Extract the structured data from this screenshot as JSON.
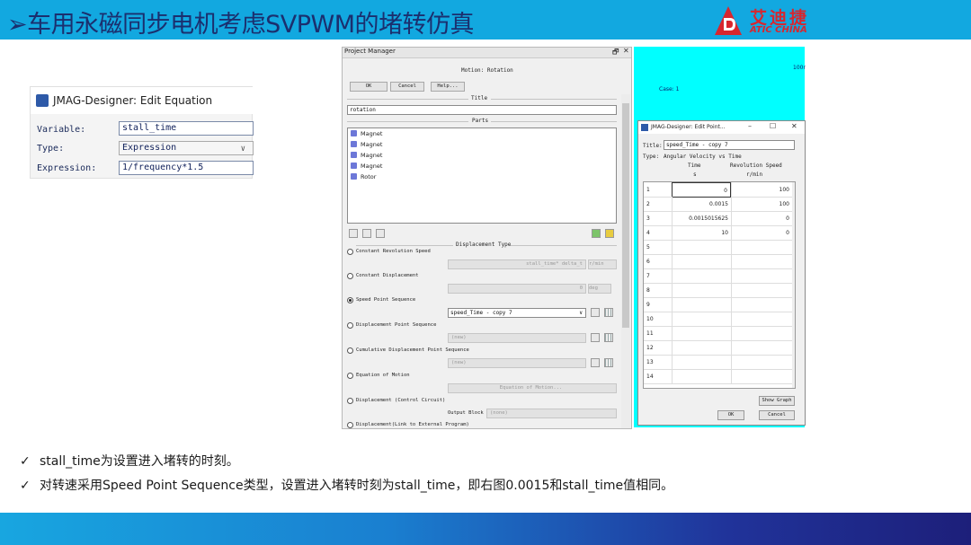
{
  "slide": {
    "title": "➢车用永磁同步电机考虑SVPWM的堵转仿真",
    "logo_cn": "艾迪捷",
    "logo_en": "ATIC CHINA",
    "accent": "#12a8e0",
    "brand_red": "#d8262e"
  },
  "bullets": [
    {
      "check": "✓",
      "text": "stall_time为设置进入堵转的时刻。"
    },
    {
      "check": "✓",
      "text": "对转速采用Speed Point Sequence类型，设置进入堵转时刻为stall_time，即右图0.0015和stall_time值相同。"
    }
  ],
  "equation_dialog": {
    "title": "JMAG-Designer: Edit Equation",
    "variable_label": "Variable:",
    "variable_value": "stall_time",
    "type_label": "Type:",
    "type_value": "Expression",
    "expression_label": "Expression:",
    "expression_value": "1/frequency*1.5"
  },
  "project_manager": {
    "title": "Project Manager",
    "header": "Motion: Rotation",
    "ok": "OK",
    "cancel": "Cancel",
    "help": "Help...",
    "title_section": "Title",
    "title_value": "rotation",
    "parts_section": "Parts",
    "parts": [
      "Magnet",
      "Magnet",
      "Magnet",
      "Magnet",
      "Rotor"
    ],
    "displacement_type": "Displacement Type",
    "options": {
      "constant_speed": "Constant Revolution Speed",
      "constant_speed_value": "stall_time* delta_t",
      "constant_speed_unit": "r/min",
      "constant_disp": "Constant Displacement",
      "constant_disp_value": "0",
      "constant_disp_unit": "deg",
      "speed_point": "Speed Point Sequence",
      "speed_point_value": "speed_Time - copy 7",
      "disp_point": "Displacement Point Sequence",
      "disp_point_value": "(new)",
      "cumulative": "Cumulative Displacement Point Sequence",
      "cumulative_value": "(new)",
      "eq_motion": "Equation of Motion",
      "eq_motion_button": "Equation of Motion...",
      "control_circuit": "Displacement (Control Circuit)",
      "output_block_label": "Output Block",
      "output_block_value": "(none)",
      "external": "Displacement(Link to External Program)"
    }
  },
  "background_panel": {
    "case": "Case: 1",
    "corner": "100r"
  },
  "edit_point": {
    "title": "JMAG-Designer: Edit Point...",
    "title_label": "Title:",
    "title_value": "speed_Time - copy 7",
    "type_label": "Type:",
    "type_value": "Angular Velocity vs Time",
    "col_time": "Time",
    "col_time_unit": "s",
    "col_speed": "Revolution Speed",
    "col_speed_unit": "r/min",
    "rows": [
      {
        "i": "1",
        "t": "0",
        "v": "100"
      },
      {
        "i": "2",
        "t": "0.0015",
        "v": "100"
      },
      {
        "i": "3",
        "t": "0.0015015625",
        "v": "0"
      },
      {
        "i": "4",
        "t": "10",
        "v": "0"
      },
      {
        "i": "5",
        "t": "",
        "v": ""
      },
      {
        "i": "6",
        "t": "",
        "v": ""
      },
      {
        "i": "7",
        "t": "",
        "v": ""
      },
      {
        "i": "8",
        "t": "",
        "v": ""
      },
      {
        "i": "9",
        "t": "",
        "v": ""
      },
      {
        "i": "10",
        "t": "",
        "v": ""
      },
      {
        "i": "11",
        "t": "",
        "v": ""
      },
      {
        "i": "12",
        "t": "",
        "v": ""
      },
      {
        "i": "13",
        "t": "",
        "v": ""
      },
      {
        "i": "14",
        "t": "",
        "v": ""
      }
    ],
    "show_graph": "Show Graph",
    "ok": "OK",
    "cancel": "Cancel"
  }
}
